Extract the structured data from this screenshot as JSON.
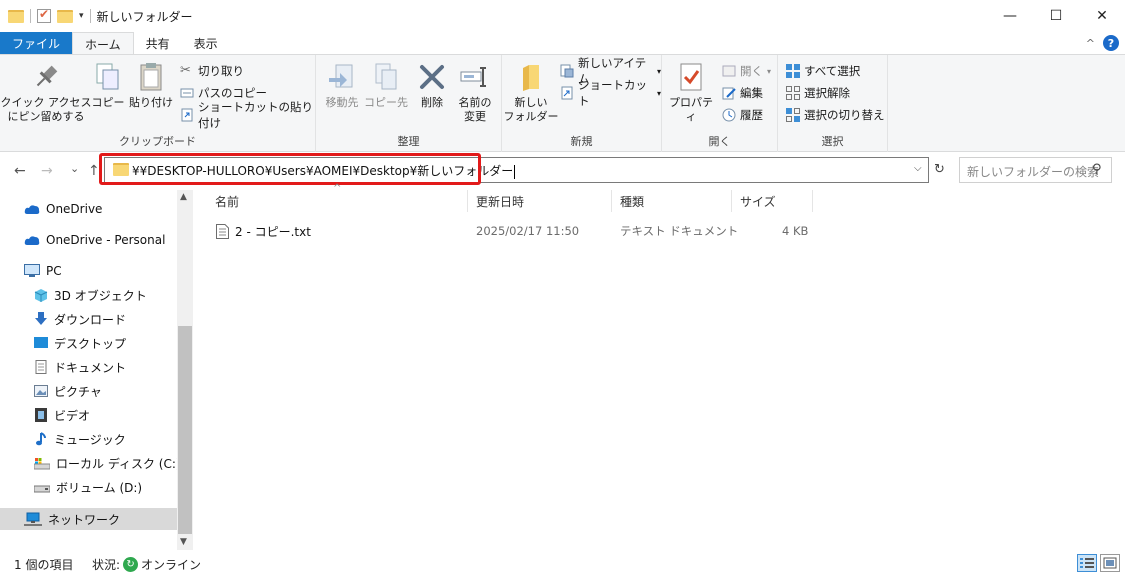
{
  "window": {
    "title": "新しいフォルダー",
    "controls": {
      "minimize": "—",
      "maximize": "☐",
      "close": "✕"
    }
  },
  "ribbon": {
    "tabs": [
      {
        "label": "ファイル",
        "kind": "file"
      },
      {
        "label": "ホーム",
        "kind": "active"
      },
      {
        "label": "共有",
        "kind": "normal"
      },
      {
        "label": "表示",
        "kind": "normal"
      }
    ],
    "help": "?",
    "collapse": "^",
    "clipboard": {
      "label": "クリップボード",
      "pin": "クイック アクセス\nにピン留めする",
      "copy": "コピー",
      "paste": "貼り付け",
      "cut": "切り取り",
      "copy_path": "パスのコピー",
      "paste_shortcut": "ショートカットの貼り付け"
    },
    "organize": {
      "label": "整理",
      "move_to": "移動先",
      "copy_to": "コピー先",
      "delete": "削除",
      "rename": "名前の\n変更"
    },
    "new": {
      "label": "新規",
      "new_folder": "新しい\nフォルダー",
      "new_item": "新しいアイテム",
      "shortcut": "ショートカット"
    },
    "open": {
      "label": "開く",
      "properties": "プロパティ",
      "open": "開く",
      "edit": "編集",
      "history": "履歴"
    },
    "select": {
      "label": "選択",
      "select_all": "すべて選択",
      "select_none": "選択解除",
      "invert": "選択の切り替え"
    }
  },
  "address": {
    "path": "¥¥DESKTOP-HULLORO¥Users¥AOMEI¥Desktop¥新しいフォルダー",
    "search_placeholder": "新しいフォルダーの検索"
  },
  "nav": {
    "back": "←",
    "forward": "→",
    "recent": "⌄",
    "up": "↑",
    "items": [
      {
        "label": "OneDrive",
        "icon": "cloud-icon"
      },
      {
        "label": "OneDrive - Personal",
        "icon": "cloud-icon"
      },
      {
        "label": "PC",
        "icon": "monitor-icon"
      },
      {
        "label": "3D オブジェクト",
        "icon": "cube-icon"
      },
      {
        "label": "ダウンロード",
        "icon": "download-icon"
      },
      {
        "label": "デスクトップ",
        "icon": "desktop-icon"
      },
      {
        "label": "ドキュメント",
        "icon": "document-icon"
      },
      {
        "label": "ピクチャ",
        "icon": "picture-icon"
      },
      {
        "label": "ビデオ",
        "icon": "video-icon"
      },
      {
        "label": "ミュージック",
        "icon": "music-icon"
      },
      {
        "label": "ローカル ディスク (C:)",
        "icon": "disk-icon"
      },
      {
        "label": "ボリューム (D:)",
        "icon": "drive-icon"
      },
      {
        "label": "ネットワーク",
        "icon": "network-icon"
      }
    ]
  },
  "columns": {
    "name": "名前",
    "modified": "更新日時",
    "type": "種類",
    "size": "サイズ"
  },
  "files": [
    {
      "name": "2 - コピー.txt",
      "modified": "2025/02/17 11:50",
      "type": "テキスト ドキュメント",
      "size": "4 KB"
    }
  ],
  "status": {
    "count": "1 個の項目",
    "state_label": "状況:",
    "state_value": "オンライン"
  },
  "colors": {
    "accent": "#1979ca",
    "highlight": "#e21a1a",
    "folder": "#f8d775"
  }
}
